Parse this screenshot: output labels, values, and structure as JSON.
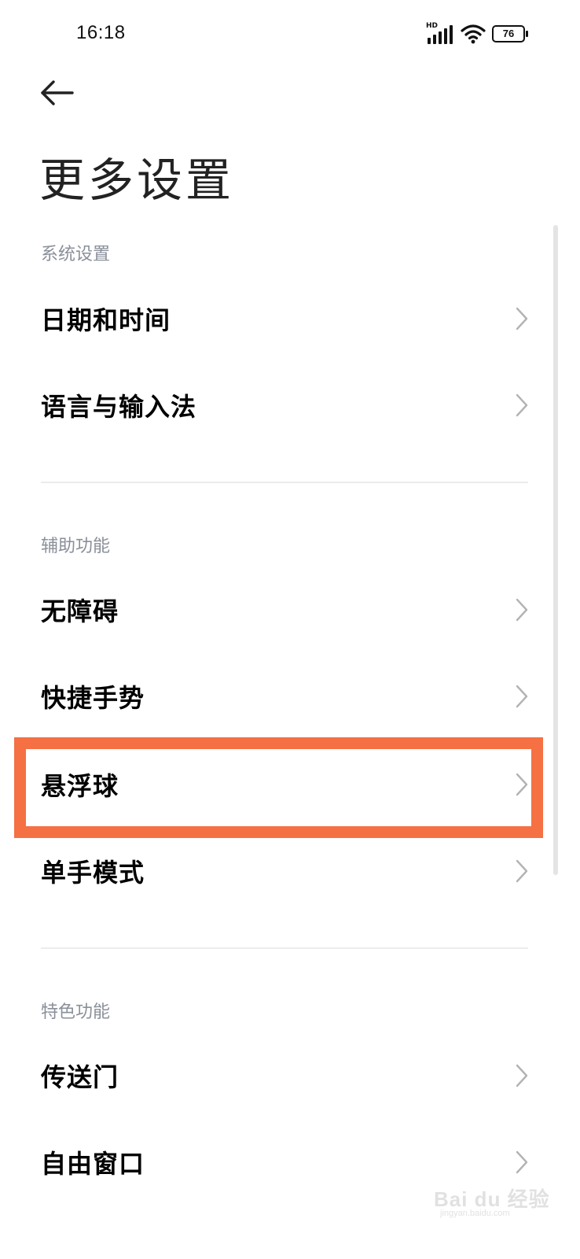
{
  "status_bar": {
    "time": "16:18",
    "network_label": "HD",
    "battery_level": "76",
    "icons": [
      "signal-icon",
      "wifi-icon",
      "battery-icon"
    ]
  },
  "header": {
    "back_icon": "back-arrow-icon",
    "title": "更多设置"
  },
  "sections": [
    {
      "header": "系统设置",
      "items": [
        {
          "label": "日期和时间",
          "icon": "chevron-right-icon"
        },
        {
          "label": "语言与输入法",
          "icon": "chevron-right-icon"
        }
      ]
    },
    {
      "header": "辅助功能",
      "items": [
        {
          "label": "无障碍",
          "icon": "chevron-right-icon"
        },
        {
          "label": "快捷手势",
          "icon": "chevron-right-icon"
        },
        {
          "label": "悬浮球",
          "icon": "chevron-right-icon",
          "highlighted": true
        },
        {
          "label": "单手模式",
          "icon": "chevron-right-icon"
        }
      ]
    },
    {
      "header": "特色功能",
      "items": [
        {
          "label": "传送门",
          "icon": "chevron-right-icon"
        },
        {
          "label": "自由窗口",
          "icon": "chevron-right-icon"
        }
      ]
    }
  ],
  "colors": {
    "highlight": "#f57042",
    "section_header": "#8a8f99",
    "divider": "#ececec"
  },
  "watermark": {
    "text": "Bai du 经验",
    "sub": "jingyan.baidu.com"
  }
}
